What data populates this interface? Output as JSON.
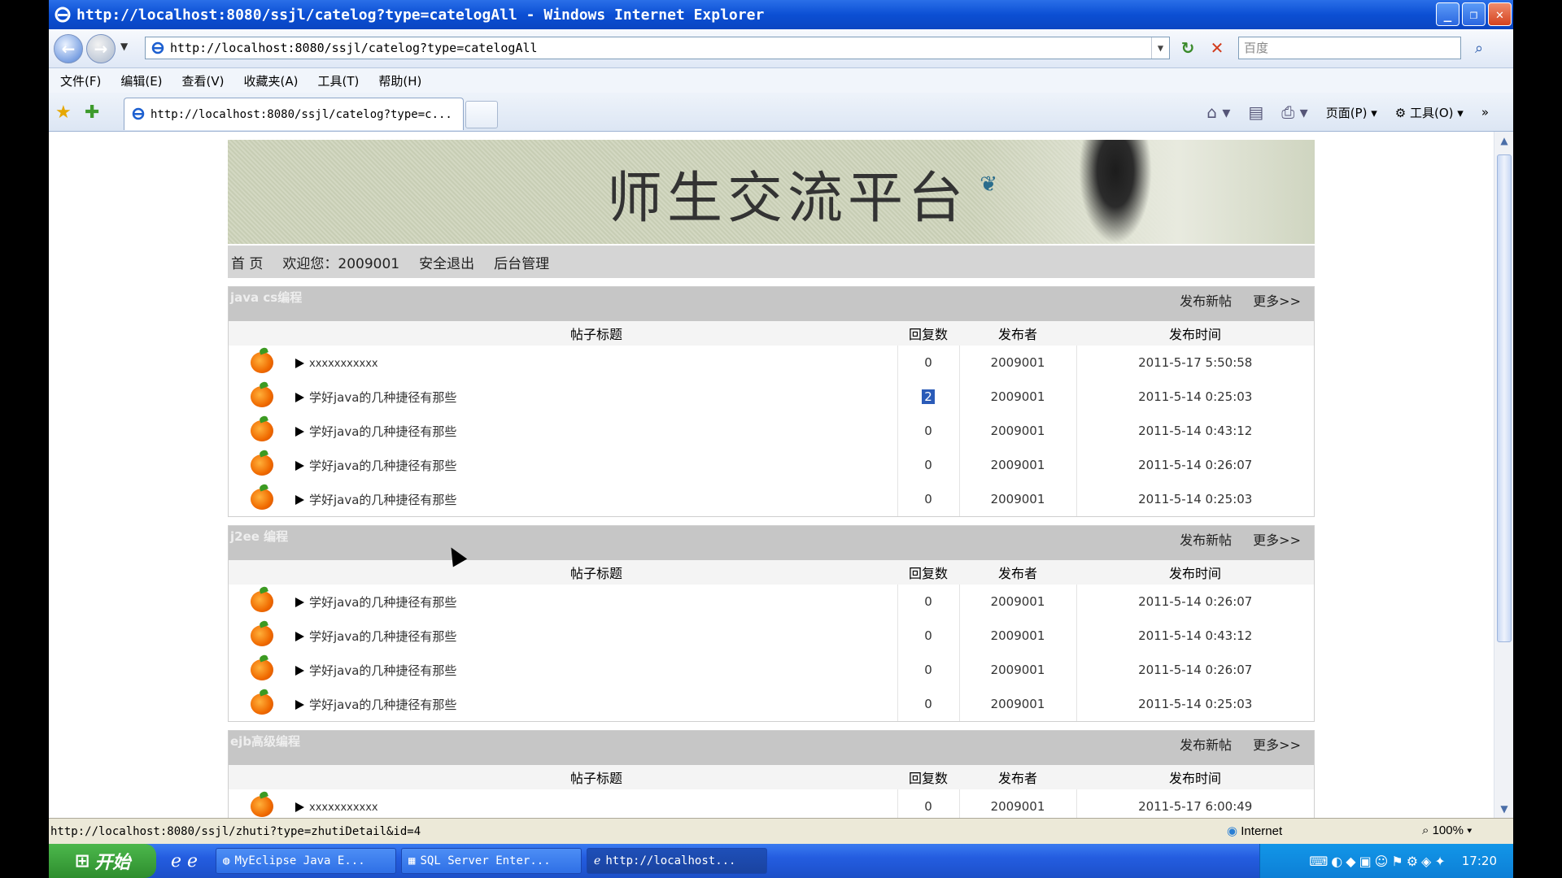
{
  "window": {
    "title": "http://localhost:8080/ssjl/catelog?type=catelogAll - Windows Internet Explorer",
    "address": "http://localhost:8080/ssjl/catelog?type=catelogAll",
    "search_placeholder": "百度",
    "tab_title": "http://localhost:8080/ssjl/catelog?type=c..."
  },
  "menu": [
    "文件(F)",
    "编辑(E)",
    "查看(V)",
    "收藏夹(A)",
    "工具(T)",
    "帮助(H)"
  ],
  "commands": {
    "page": "页面(P)",
    "tools": "工具(O)"
  },
  "site": {
    "banner_title": "师生交流平台",
    "nav": {
      "home": "首 页",
      "welcome": "欢迎您：2009001",
      "logout": "安全退出",
      "admin": "后台管理"
    }
  },
  "columns": {
    "title": "帖子标题",
    "replies": "回复数",
    "author": "发布者",
    "time": "发布时间"
  },
  "actions": {
    "new_post": "发布新帖",
    "more": "更多>>"
  },
  "sections": [
    {
      "name": "java cs编程",
      "posts": [
        {
          "title": "xxxxxxxxxxx",
          "replies": "0",
          "author": "2009001",
          "time": "2011-5-17 5:50:58"
        },
        {
          "title": "学好java的几种捷径有那些",
          "replies": "2",
          "author": "2009001",
          "time": "2011-5-14 0:25:03"
        },
        {
          "title": "学好java的几种捷径有那些",
          "replies": "0",
          "author": "2009001",
          "time": "2011-5-14 0:43:12"
        },
        {
          "title": "学好java的几种捷径有那些",
          "replies": "0",
          "author": "2009001",
          "time": "2011-5-14 0:26:07"
        },
        {
          "title": "学好java的几种捷径有那些",
          "replies": "0",
          "author": "2009001",
          "time": "2011-5-14 0:25:03"
        }
      ]
    },
    {
      "name": "j2ee 编程",
      "posts": [
        {
          "title": "学好java的几种捷径有那些",
          "replies": "0",
          "author": "2009001",
          "time": "2011-5-14 0:26:07"
        },
        {
          "title": "学好java的几种捷径有那些",
          "replies": "0",
          "author": "2009001",
          "time": "2011-5-14 0:43:12"
        },
        {
          "title": "学好java的几种捷径有那些",
          "replies": "0",
          "author": "2009001",
          "time": "2011-5-14 0:26:07"
        },
        {
          "title": "学好java的几种捷径有那些",
          "replies": "0",
          "author": "2009001",
          "time": "2011-5-14 0:25:03"
        }
      ]
    },
    {
      "name": "ejb高级编程",
      "posts": [
        {
          "title": "xxxxxxxxxxx",
          "replies": "0",
          "author": "2009001",
          "time": "2011-5-17 6:00:49"
        }
      ]
    }
  ],
  "status": {
    "url": "http://localhost:8080/ssjl/zhuti?type=zhutiDetail&id=4",
    "zone": "Internet",
    "zoom": "100%"
  },
  "taskbar": {
    "start": "开始",
    "tasks": [
      "MyEclipse Java E...",
      "SQL Server Enter...",
      "http://localhost..."
    ],
    "clock": "17:20"
  },
  "colors": {
    "titlebar": "#0b4fd4",
    "section_header": "#c6c6c6",
    "nav_bg": "#d5d5d5",
    "highlight": "#2a5bb8"
  }
}
